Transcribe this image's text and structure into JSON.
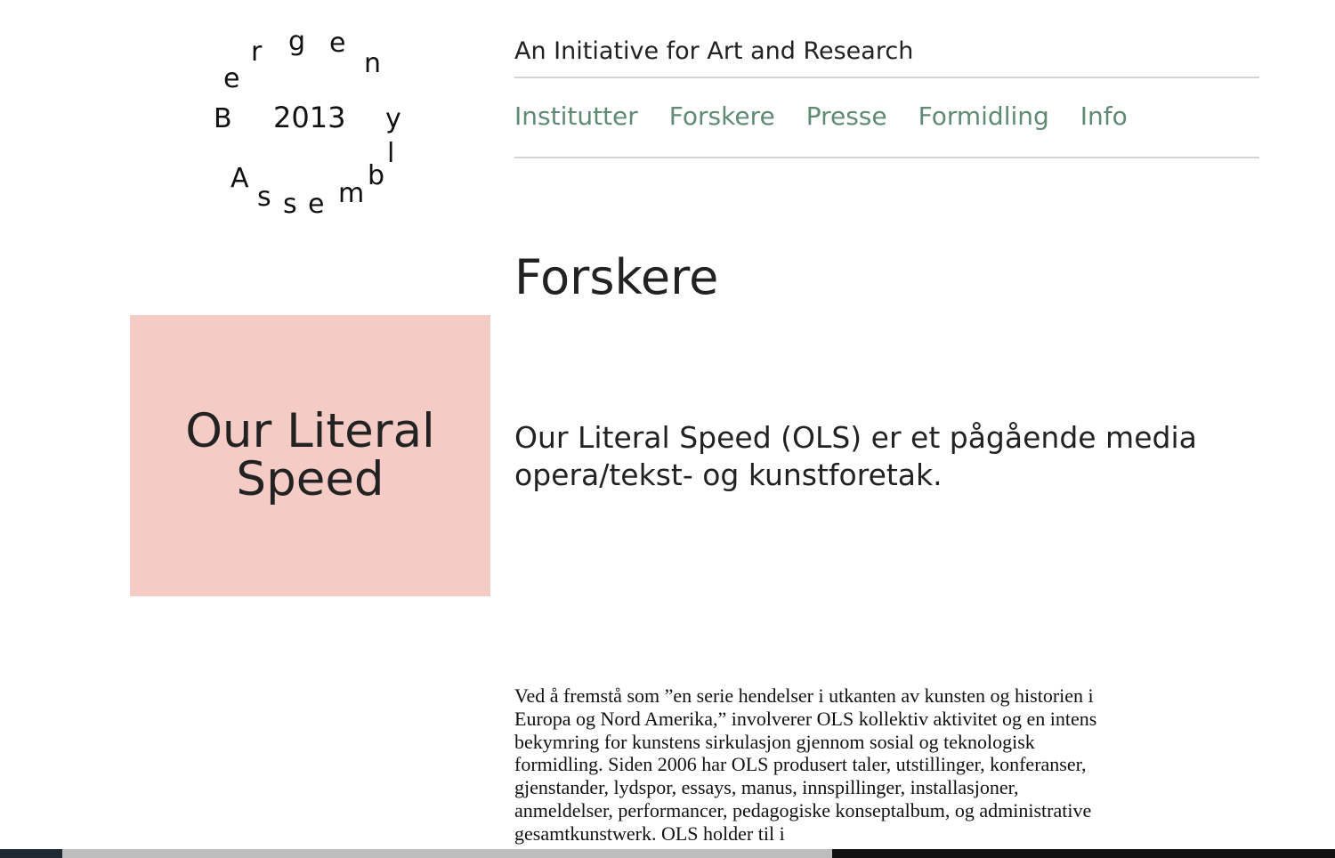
{
  "logo": {
    "letters": [
      "e",
      "r",
      "g",
      "e",
      "n",
      "B",
      "y",
      "l",
      "A",
      "s",
      "s",
      "e",
      "m",
      "b"
    ],
    "year": "2013"
  },
  "header": {
    "tagline": "An Initiative for Art and Research"
  },
  "nav": {
    "items": [
      {
        "label": "Institutter"
      },
      {
        "label": "Forskere"
      },
      {
        "label": "Presse"
      },
      {
        "label": "Formidling"
      },
      {
        "label": "Info"
      }
    ],
    "link_color": "#5f8a73"
  },
  "page": {
    "title": "Forskere"
  },
  "feature": {
    "title": "Our Literal Speed",
    "background": "#f5ccc5"
  },
  "content": {
    "lead": "Our Literal Speed (OLS) er et pågående media opera/tekst- og kunstforetak.",
    "body": "Ved å fremstå som ”en serie hendelser i utkanten av kunsten og historien i Europa og Nord Amerika,” involverer OLS kollektiv aktivitet og en intens bekymring for kunstens sirkulasjon gjennom sosial og teknologisk formidling. Siden 2006 har OLS produsert taler, utstillinger, konferanser, gjenstander, lydspor, essays, manus, innspillinger, installasjoner, anmeldelser, performancer, pedagogiske konseptalbum, og administrative gesamtkunstwerk.  OLS holder til i"
  }
}
